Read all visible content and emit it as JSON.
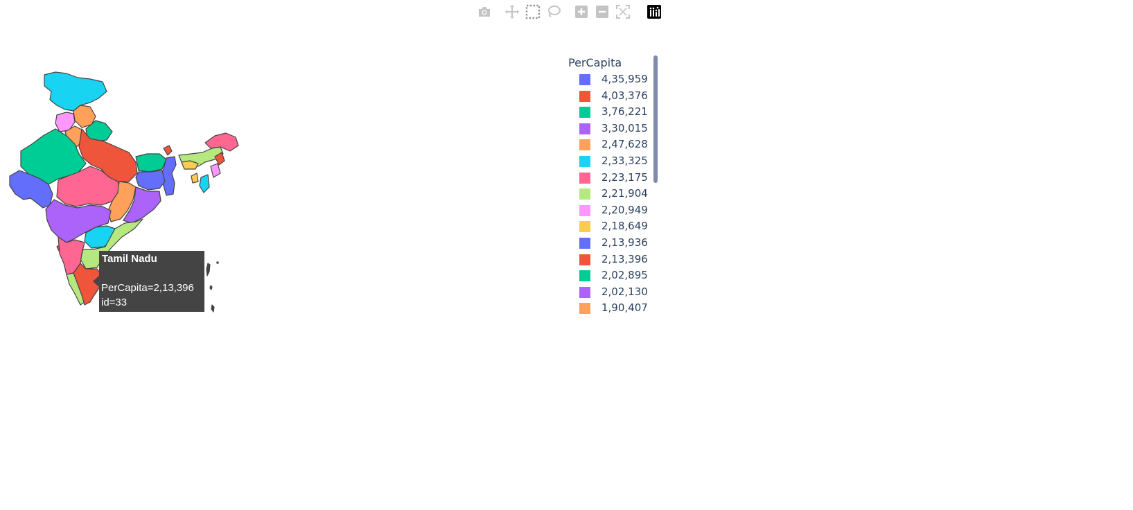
{
  "modebar": {
    "buttons": [
      {
        "name": "camera-icon",
        "title": "Download plot as a png"
      },
      {
        "name": "pan-icon",
        "title": "Pan"
      },
      {
        "name": "box-select-icon",
        "title": "Box Select"
      },
      {
        "name": "lasso-select-icon",
        "title": "Lasso Select"
      },
      {
        "name": "zoom-in-icon",
        "title": "Zoom in"
      },
      {
        "name": "zoom-out-icon",
        "title": "Zoom out"
      },
      {
        "name": "reset-view-icon",
        "title": "Reset view"
      },
      {
        "name": "plotly-logo-icon",
        "title": "Produced with Plotly"
      }
    ]
  },
  "legend": {
    "title": "PerCapita",
    "items": [
      {
        "label": "4,35,959",
        "color": "#636efa"
      },
      {
        "label": "4,03,376",
        "color": "#ef553b"
      },
      {
        "label": "3,76,221",
        "color": "#00cc96"
      },
      {
        "label": "3,30,015",
        "color": "#ab63fa"
      },
      {
        "label": "2,47,628",
        "color": "#ffa15a"
      },
      {
        "label": "2,33,325",
        "color": "#19d3f3"
      },
      {
        "label": "2,23,175",
        "color": "#ff6692"
      },
      {
        "label": "2,21,904",
        "color": "#b6e880"
      },
      {
        "label": "2,20,949",
        "color": "#ff97ff"
      },
      {
        "label": "2,18,649",
        "color": "#fecb52"
      },
      {
        "label": "2,13,936",
        "color": "#636efa"
      },
      {
        "label": "2,13,396",
        "color": "#ef553b"
      },
      {
        "label": "2,02,895",
        "color": "#00cc96"
      },
      {
        "label": "2,02,130",
        "color": "#ab63fa"
      },
      {
        "label": "1,90,407",
        "color": "#ffa15a"
      }
    ]
  },
  "hover": {
    "title": "Tamil Nadu",
    "line1": "PerCapita=2,13,396",
    "line2": "id=33"
  }
}
